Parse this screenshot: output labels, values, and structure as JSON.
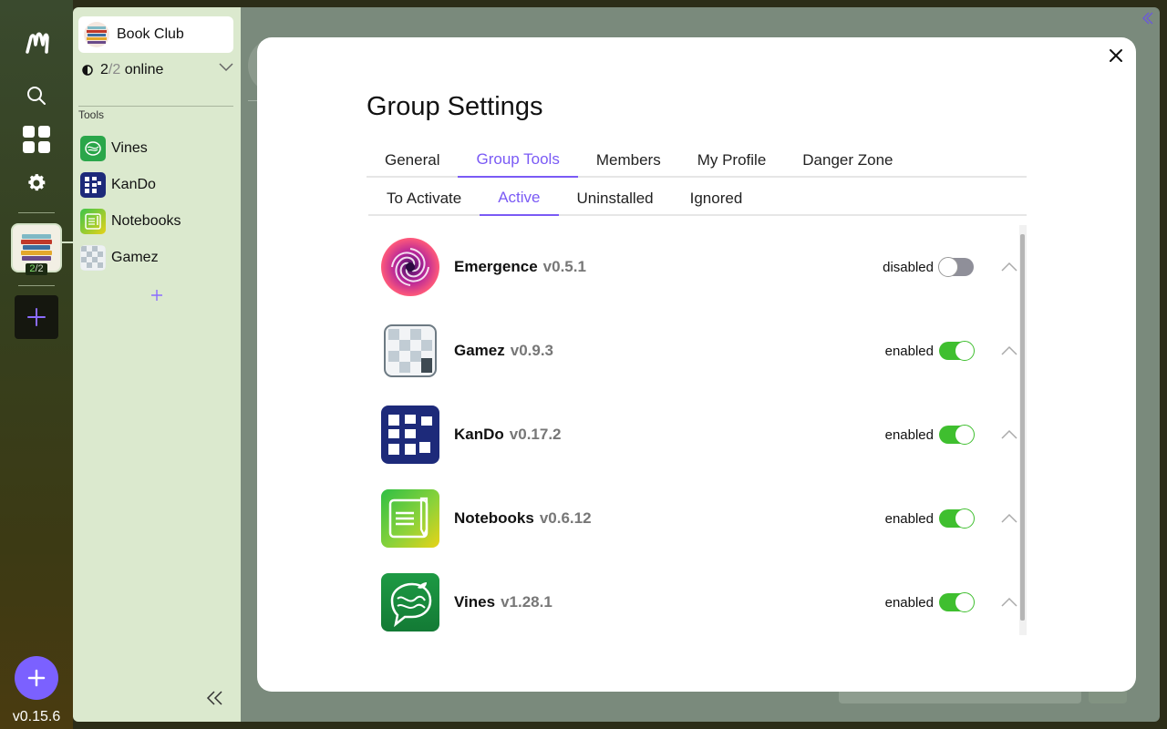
{
  "app": {
    "version": "v0.15.6"
  },
  "rail": {
    "group_online": "2",
    "group_total": "2"
  },
  "group": {
    "name": "Book Club",
    "online_count": "2",
    "online_total": "2",
    "online_label": "online",
    "tools_heading": "Tools",
    "tools": [
      {
        "label": "Vines",
        "icon": "vines-icon"
      },
      {
        "label": "KanDo",
        "icon": "kando-icon"
      },
      {
        "label": "Notebooks",
        "icon": "notebooks-icon"
      },
      {
        "label": "Gamez",
        "icon": "gamez-icon"
      }
    ]
  },
  "modal": {
    "title": "Group Settings",
    "tabs": [
      {
        "label": "General"
      },
      {
        "label": "Group Tools"
      },
      {
        "label": "Members"
      },
      {
        "label": "My Profile"
      },
      {
        "label": "Danger Zone"
      }
    ],
    "active_tab": "Group Tools",
    "subtabs": [
      {
        "label": "To Activate"
      },
      {
        "label": "Active"
      },
      {
        "label": "Uninstalled"
      },
      {
        "label": "Ignored"
      }
    ],
    "active_subtab": "Active",
    "tools": [
      {
        "name": "Emergence",
        "version": "v0.5.1",
        "status": "disabled",
        "enabled": false,
        "icon": "emergence-icon"
      },
      {
        "name": "Gamez",
        "version": "v0.9.3",
        "status": "enabled",
        "enabled": true,
        "icon": "gamez-icon"
      },
      {
        "name": "KanDo",
        "version": "v0.17.2",
        "status": "enabled",
        "enabled": true,
        "icon": "kando-icon"
      },
      {
        "name": "Notebooks",
        "version": "v0.6.12",
        "status": "enabled",
        "enabled": true,
        "icon": "notebooks-icon"
      },
      {
        "name": "Vines",
        "version": "v1.28.1",
        "status": "enabled",
        "enabled": true,
        "icon": "vines-icon"
      }
    ]
  },
  "colors": {
    "accent": "#7a5af5",
    "toggle_on": "#3fbf2f",
    "toggle_off": "#8f8f99",
    "sidebar_bg": "#dbe9ce"
  }
}
